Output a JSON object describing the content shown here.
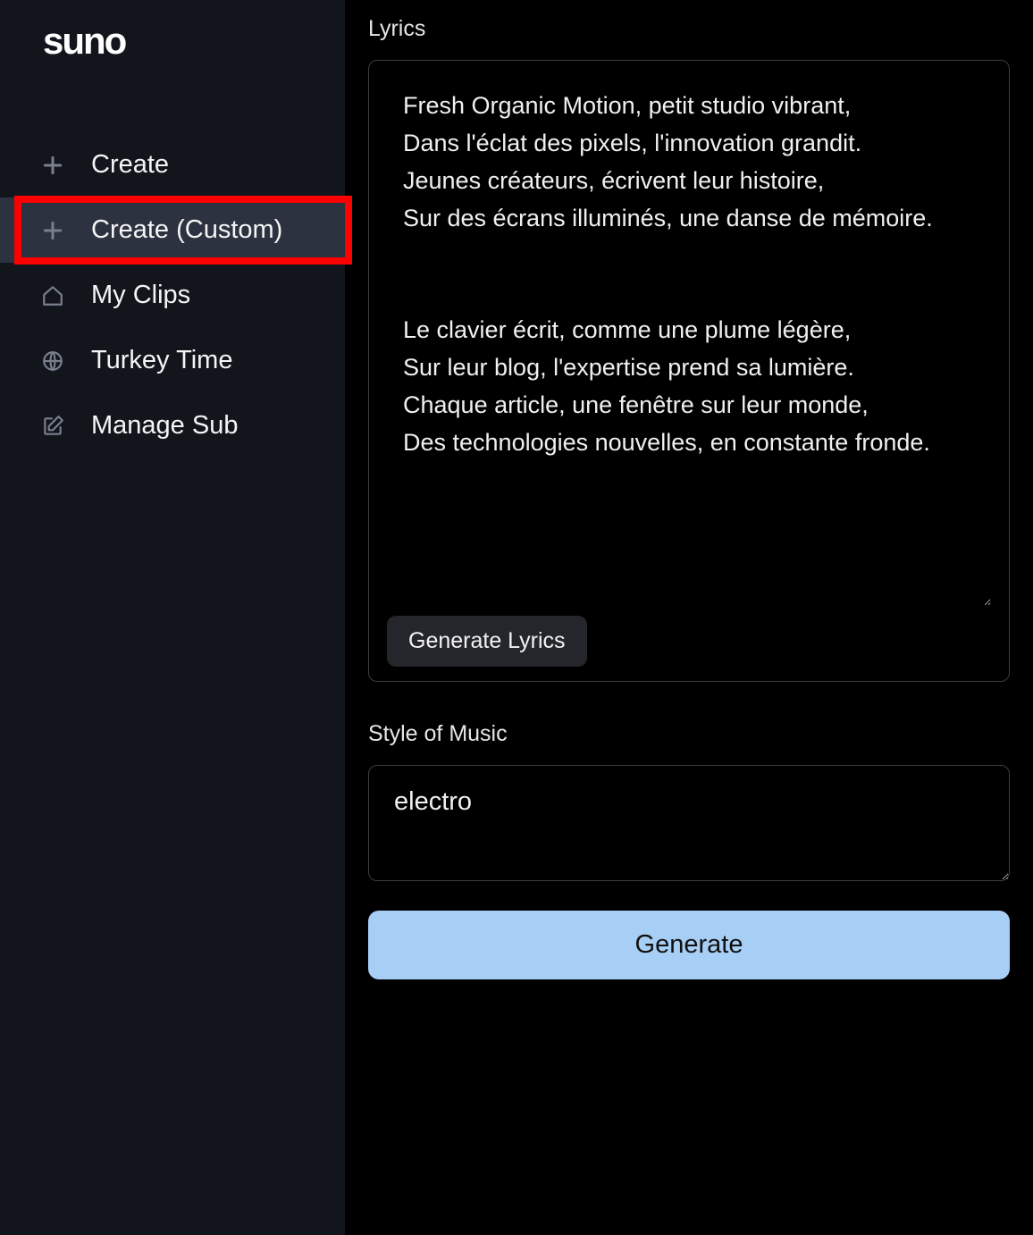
{
  "logo": "suno",
  "sidebar": {
    "items": [
      {
        "label": "Create",
        "icon": "plus"
      },
      {
        "label": "Create (Custom)",
        "icon": "plus"
      },
      {
        "label": "My Clips",
        "icon": "home"
      },
      {
        "label": "Turkey Time",
        "icon": "globe"
      },
      {
        "label": "Manage Sub",
        "icon": "edit"
      }
    ]
  },
  "main": {
    "lyrics_label": "Lyrics",
    "lyrics_value": "Fresh Organic Motion, petit studio vibrant,\nDans l'éclat des pixels, l'innovation grandit.\nJeunes créateurs, écrivent leur histoire,\nSur des écrans illuminés, une danse de mémoire.\n\n\nLe clavier écrit, comme une plume légère,\nSur leur blog, l'expertise prend sa lumière.\nChaque article, une fenêtre sur leur monde,\nDes technologies nouvelles, en constante fronde.",
    "generate_lyrics_label": "Generate Lyrics",
    "style_label": "Style of Music",
    "style_value": "electro",
    "generate_label": "Generate"
  }
}
